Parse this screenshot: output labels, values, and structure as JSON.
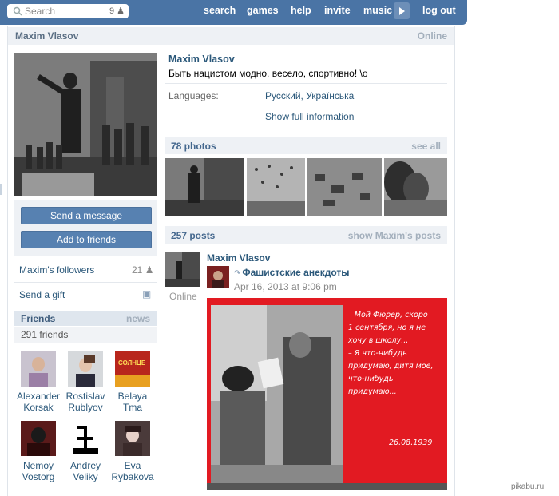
{
  "topbar": {
    "search_placeholder": "Search",
    "search_count": "9",
    "nav": [
      "search",
      "games",
      "help",
      "invite",
      "music"
    ],
    "logout": "log out"
  },
  "page_header": {
    "name": "Maxim Vlasov",
    "status": "Online"
  },
  "profile": {
    "name": "Maxim Vlasov",
    "status_text": "Быть нацистом модно, весело, спортивно! \\o",
    "languages_label": "Languages:",
    "languages_value": "Русский, Українська",
    "show_full": "Show full information"
  },
  "actions": {
    "send_message": "Send a message",
    "add_friends": "Add to friends"
  },
  "followers": {
    "label": "Maxim's followers",
    "count": "21"
  },
  "gift": {
    "label": "Send a gift"
  },
  "friends": {
    "title": "Friends",
    "news": "news",
    "count_text": "291 friends",
    "items": [
      {
        "first": "Alexander",
        "last": "Korsak"
      },
      {
        "first": "Rostislav",
        "last": "Rublyov"
      },
      {
        "first": "Belaya",
        "last": "Tma"
      },
      {
        "first": "Nemoy",
        "last": "Vostorg"
      },
      {
        "first": "Andrey",
        "last": "Veliky"
      },
      {
        "first": "Eva",
        "last": "Rybakova"
      }
    ],
    "thumb_caption": "СОЛНЦЕ"
  },
  "photos": {
    "title": "78 photos",
    "see_all": "see all"
  },
  "posts": {
    "title": "257 posts",
    "show_all": "show Maxim's posts",
    "author": "Maxim Vlasov",
    "author_status": "Online",
    "group": "Фашистские анекдоты",
    "date": "Apr 16, 2013 at 9:06 pm",
    "image_quote": [
      "– Мой Фюрер, скоро",
      "1 сентября, но я не",
      "хочу в школу...",
      "– Я что-нибудь",
      "придумаю, дитя мое,",
      "что-нибудь",
      "придумаю..."
    ],
    "image_date": "26.08.1939"
  },
  "watermark": "pikabu.ru",
  "colors": {
    "topbar": "#4a74a5",
    "link": "#2b587a",
    "button": "#5781b1",
    "post_bg": "#e21a22"
  }
}
